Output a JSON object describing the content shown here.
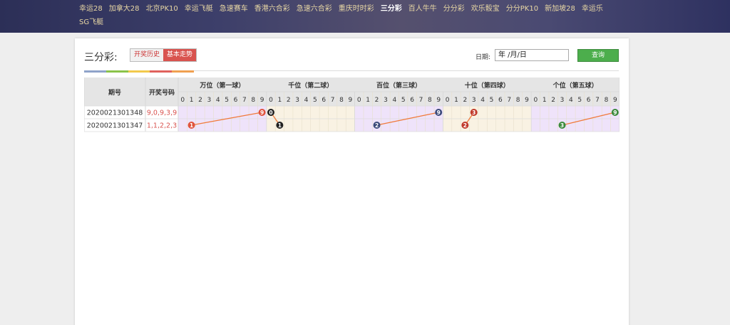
{
  "nav": {
    "items": [
      "幸运28",
      "加拿大28",
      "北京PK10",
      "幸运飞艇",
      "急速赛车",
      "香港六合彩",
      "急速六合彩",
      "重庆时时彩",
      "三分彩",
      "百人牛牛",
      "分分彩",
      "欢乐骰宝",
      "分分PK10",
      "新加坡28",
      "幸运乐",
      "SG飞艇"
    ],
    "active_index": 8
  },
  "page": {
    "title": "三分彩:",
    "tab_history": "开奖历史",
    "tab_trend": "基本走势",
    "date_label": "日期:",
    "date_placeholder": "年 /月/日",
    "query_button": "查询"
  },
  "strip_colors": [
    "#8fa3c9",
    "#8bc34a",
    "#f2c94c",
    "#e0625c",
    "#f0a050"
  ],
  "table": {
    "col_issue": "期号",
    "col_numbers": "开奖号码",
    "positions": [
      "万位（第一球）",
      "千位（第二球）",
      "百位（第三球）",
      "十位（第四球）",
      "个位（第五球）"
    ],
    "digits": [
      "0",
      "1",
      "2",
      "3",
      "4",
      "5",
      "6",
      "7",
      "8",
      "9"
    ],
    "zone_colors": [
      "#efe3fa",
      "#f9f2e3",
      "#efe3fa",
      "#f9f2e3",
      "#efe3fa"
    ],
    "ball_colors": [
      "#e0533c",
      "#222222",
      "#3c4a7a",
      "#c0392b",
      "#3a8a3a"
    ],
    "line_color": "#f07a3a",
    "rows": [
      {
        "issue": "2020021301348",
        "numbers": "9,0,9,3,9",
        "digits": [
          9,
          0,
          9,
          3,
          9
        ]
      },
      {
        "issue": "2020021301347",
        "numbers": "1,1,2,2,3",
        "digits": [
          1,
          1,
          2,
          2,
          3
        ]
      }
    ]
  }
}
